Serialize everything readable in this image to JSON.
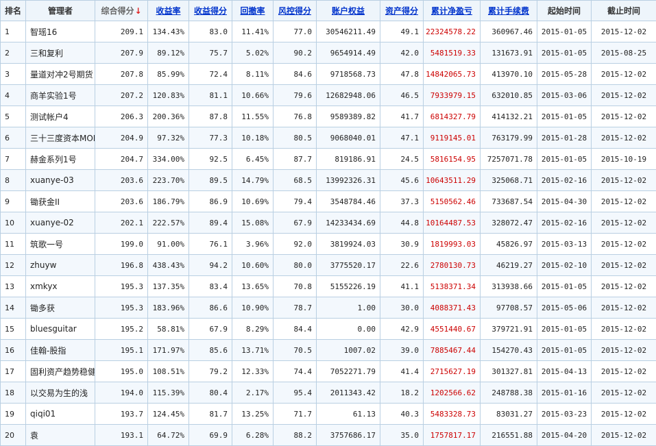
{
  "headers": {
    "rank": "排名",
    "manager": "管理者",
    "score": "综合得分",
    "sort_arrow": "↓",
    "return_rate": "收益率",
    "return_score": "收益得分",
    "drawdown": "回撤率",
    "risk_score": "风控得分",
    "equity": "账户权益",
    "asset_score": "资产得分",
    "net_profit": "累计净盈亏",
    "fees": "累计手续费",
    "start_date": "起始时间",
    "end_date": "截止时间"
  },
  "rows": [
    {
      "rank": "1",
      "manager": "智瑶16",
      "score": "209.1",
      "return_rate": "134.43%",
      "return_score": "83.0",
      "drawdown": "11.41%",
      "risk_score": "77.0",
      "equity": "30546211.49",
      "asset_score": "49.1",
      "net_profit": "22324578.22",
      "fees": "360967.46",
      "start": "2015-01-05",
      "end": "2015-12-02"
    },
    {
      "rank": "2",
      "manager": "三和复利",
      "score": "207.9",
      "return_rate": "89.12%",
      "return_score": "75.7",
      "drawdown": "5.02%",
      "risk_score": "90.2",
      "equity": "9654914.49",
      "asset_score": "42.0",
      "net_profit": "5481519.33",
      "fees": "131673.91",
      "start": "2015-01-05",
      "end": "2015-08-25"
    },
    {
      "rank": "3",
      "manager": "量道对冲2号期货",
      "score": "207.8",
      "return_rate": "85.99%",
      "return_score": "72.4",
      "drawdown": "8.11%",
      "risk_score": "84.6",
      "equity": "9718568.73",
      "asset_score": "47.8",
      "net_profit": "14842065.73",
      "fees": "413970.10",
      "start": "2015-05-28",
      "end": "2015-12-02"
    },
    {
      "rank": "4",
      "manager": "商羊实验1号",
      "score": "207.2",
      "return_rate": "120.83%",
      "return_score": "81.1",
      "drawdown": "10.66%",
      "risk_score": "79.6",
      "equity": "12682948.06",
      "asset_score": "46.5",
      "net_profit": "7933979.15",
      "fees": "632010.85",
      "start": "2015-03-06",
      "end": "2015-12-02"
    },
    {
      "rank": "5",
      "manager": "测试帐户4",
      "score": "206.3",
      "return_rate": "200.36%",
      "return_score": "87.8",
      "drawdown": "11.55%",
      "risk_score": "76.8",
      "equity": "9589389.82",
      "asset_score": "41.7",
      "net_profit": "6814327.79",
      "fees": "414132.21",
      "start": "2015-01-05",
      "end": "2015-12-02"
    },
    {
      "rank": "6",
      "manager": "三十三度资本MOM",
      "score": "204.9",
      "return_rate": "97.32%",
      "return_score": "77.3",
      "drawdown": "10.18%",
      "risk_score": "80.5",
      "equity": "9068040.01",
      "asset_score": "47.1",
      "net_profit": "9119145.01",
      "fees": "763179.99",
      "start": "2015-01-28",
      "end": "2015-12-02"
    },
    {
      "rank": "7",
      "manager": "赫金系列1号",
      "score": "204.7",
      "return_rate": "334.00%",
      "return_score": "92.5",
      "drawdown": "6.45%",
      "risk_score": "87.7",
      "equity": "819186.91",
      "asset_score": "24.5",
      "net_profit": "5816154.95",
      "fees": "7257071.78",
      "start": "2015-01-05",
      "end": "2015-10-19"
    },
    {
      "rank": "8",
      "manager": "xuanye-03",
      "score": "203.6",
      "return_rate": "223.70%",
      "return_score": "89.5",
      "drawdown": "14.79%",
      "risk_score": "68.5",
      "equity": "13992326.31",
      "asset_score": "45.6",
      "net_profit": "10643511.29",
      "fees": "325068.71",
      "start": "2015-02-16",
      "end": "2015-12-02"
    },
    {
      "rank": "9",
      "manager": "锄获金II",
      "score": "203.6",
      "return_rate": "186.79%",
      "return_score": "86.9",
      "drawdown": "10.69%",
      "risk_score": "79.4",
      "equity": "3548784.46",
      "asset_score": "37.3",
      "net_profit": "5150562.46",
      "fees": "733687.54",
      "start": "2015-04-30",
      "end": "2015-12-02"
    },
    {
      "rank": "10",
      "manager": "xuanye-02",
      "score": "202.1",
      "return_rate": "222.57%",
      "return_score": "89.4",
      "drawdown": "15.08%",
      "risk_score": "67.9",
      "equity": "14233434.69",
      "asset_score": "44.8",
      "net_profit": "10164487.53",
      "fees": "328072.47",
      "start": "2015-02-16",
      "end": "2015-12-02"
    },
    {
      "rank": "11",
      "manager": "筑歌一号",
      "score": "199.0",
      "return_rate": "91.00%",
      "return_score": "76.1",
      "drawdown": "3.96%",
      "risk_score": "92.0",
      "equity": "3819924.03",
      "asset_score": "30.9",
      "net_profit": "1819993.03",
      "fees": "45826.97",
      "start": "2015-03-13",
      "end": "2015-12-02"
    },
    {
      "rank": "12",
      "manager": "zhuyw",
      "score": "196.8",
      "return_rate": "438.43%",
      "return_score": "94.2",
      "drawdown": "10.60%",
      "risk_score": "80.0",
      "equity": "3775520.17",
      "asset_score": "22.6",
      "net_profit": "2780130.73",
      "fees": "46219.27",
      "start": "2015-02-10",
      "end": "2015-12-02"
    },
    {
      "rank": "13",
      "manager": "xmkyx",
      "score": "195.3",
      "return_rate": "137.35%",
      "return_score": "83.4",
      "drawdown": "13.65%",
      "risk_score": "70.8",
      "equity": "5155226.19",
      "asset_score": "41.1",
      "net_profit": "5138371.34",
      "fees": "313938.66",
      "start": "2015-01-05",
      "end": "2015-12-02"
    },
    {
      "rank": "14",
      "manager": "锄多获",
      "score": "195.3",
      "return_rate": "183.96%",
      "return_score": "86.6",
      "drawdown": "10.90%",
      "risk_score": "78.7",
      "equity": "1.00",
      "asset_score": "30.0",
      "net_profit": "4088371.43",
      "fees": "97708.57",
      "start": "2015-05-06",
      "end": "2015-12-02"
    },
    {
      "rank": "15",
      "manager": "bluesguitar",
      "score": "195.2",
      "return_rate": "58.81%",
      "return_score": "67.9",
      "drawdown": "8.29%",
      "risk_score": "84.4",
      "equity": "0.00",
      "asset_score": "42.9",
      "net_profit": "4551440.67",
      "fees": "379721.91",
      "start": "2015-01-05",
      "end": "2015-12-02"
    },
    {
      "rank": "16",
      "manager": "佳翰-股指",
      "score": "195.1",
      "return_rate": "171.97%",
      "return_score": "85.6",
      "drawdown": "13.71%",
      "risk_score": "70.5",
      "equity": "1007.02",
      "asset_score": "39.0",
      "net_profit": "7885467.44",
      "fees": "154270.43",
      "start": "2015-01-05",
      "end": "2015-12-02"
    },
    {
      "rank": "17",
      "manager": "固利资产趋势稳健",
      "score": "195.0",
      "return_rate": "108.51%",
      "return_score": "79.2",
      "drawdown": "12.33%",
      "risk_score": "74.4",
      "equity": "7052271.79",
      "asset_score": "41.4",
      "net_profit": "2715627.19",
      "fees": "301327.81",
      "start": "2015-04-13",
      "end": "2015-12-02"
    },
    {
      "rank": "18",
      "manager": "以交易为生的浅",
      "score": "194.0",
      "return_rate": "115.39%",
      "return_score": "80.4",
      "drawdown": "2.17%",
      "risk_score": "95.4",
      "equity": "2011343.42",
      "asset_score": "18.2",
      "net_profit": "1202566.62",
      "fees": "248788.38",
      "start": "2015-01-16",
      "end": "2015-12-02"
    },
    {
      "rank": "19",
      "manager": "qiqi01",
      "score": "193.7",
      "return_rate": "124.45%",
      "return_score": "81.7",
      "drawdown": "13.25%",
      "risk_score": "71.7",
      "equity": "61.13",
      "asset_score": "40.3",
      "net_profit": "5483328.73",
      "fees": "83031.27",
      "start": "2015-03-23",
      "end": "2015-12-02"
    },
    {
      "rank": "20",
      "manager": "袁",
      "score": "193.1",
      "return_rate": "64.72%",
      "return_score": "69.9",
      "drawdown": "6.28%",
      "risk_score": "88.2",
      "equity": "3757686.17",
      "asset_score": "35.0",
      "net_profit": "1757817.17",
      "fees": "216551.88",
      "start": "2015-04-20",
      "end": "2015-12-02"
    }
  ]
}
